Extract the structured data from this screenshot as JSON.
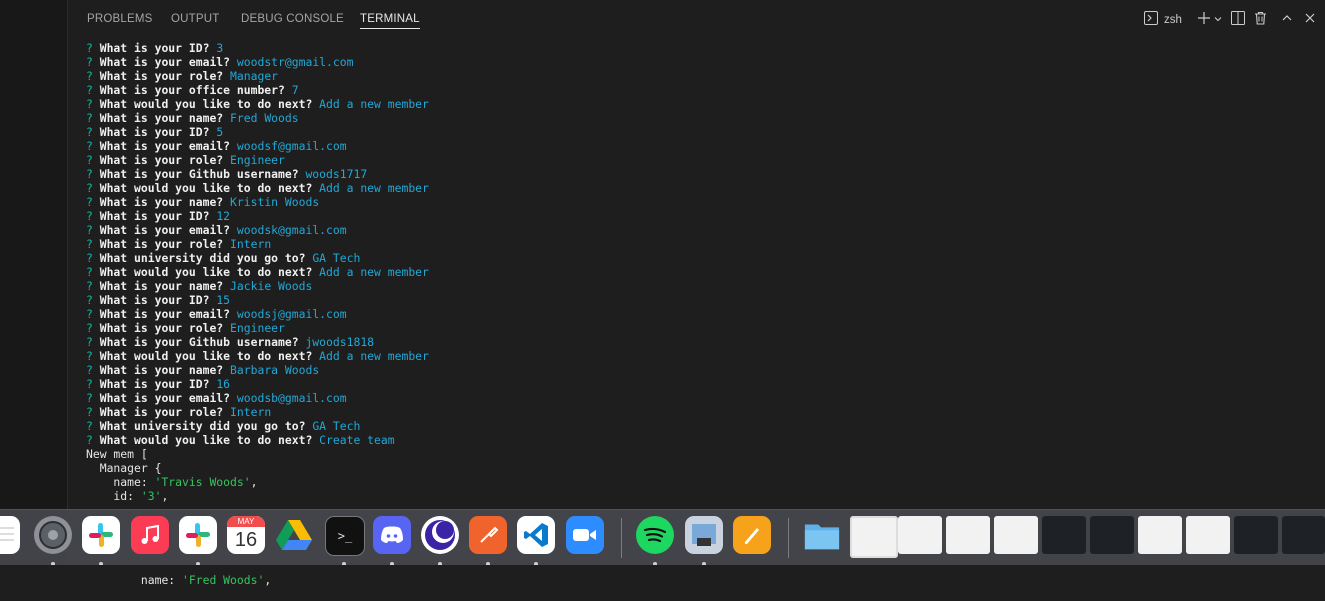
{
  "tabs": [
    {
      "label": "PROBLEMS"
    },
    {
      "label": "OUTPUT"
    },
    {
      "label": "DEBUG CONSOLE"
    },
    {
      "label": "TERMINAL"
    }
  ],
  "toolbar": {
    "shell_label": "zsh"
  },
  "terminal": {
    "prompt_char": "?",
    "lines": [
      {
        "prompt": "What is your ID?",
        "answer": "3"
      },
      {
        "prompt": "What is your email?",
        "answer": "woodstr@gmail.com"
      },
      {
        "prompt": "What is your role?",
        "answer": "Manager"
      },
      {
        "prompt": "What is your office number?",
        "answer": "7"
      },
      {
        "prompt": "What would you like to do next?",
        "answer": "Add a new member"
      },
      {
        "prompt": "What is your name?",
        "answer": "Fred Woods"
      },
      {
        "prompt": "What is your ID?",
        "answer": "5"
      },
      {
        "prompt": "What is your email?",
        "answer": "woodsf@gmail.com"
      },
      {
        "prompt": "What is your role?",
        "answer": "Engineer"
      },
      {
        "prompt": "What is your Github username?",
        "answer": "woods1717"
      },
      {
        "prompt": "What would you like to do next?",
        "answer": "Add a new member"
      },
      {
        "prompt": "What is your name?",
        "answer": "Kristin Woods"
      },
      {
        "prompt": "What is your ID?",
        "answer": "12"
      },
      {
        "prompt": "What is your email?",
        "answer": "woodsk@gmail.com"
      },
      {
        "prompt": "What is your role?",
        "answer": "Intern"
      },
      {
        "prompt": "What university did you go to?",
        "answer": "GA Tech"
      },
      {
        "prompt": "What would you like to do next?",
        "answer": "Add a new member"
      },
      {
        "prompt": "What is your name?",
        "answer": "Jackie Woods"
      },
      {
        "prompt": "What is your ID?",
        "answer": "15"
      },
      {
        "prompt": "What is your email?",
        "answer": "woodsj@gmail.com"
      },
      {
        "prompt": "What is your role?",
        "answer": "Engineer"
      },
      {
        "prompt": "What is your Github username?",
        "answer": "jwoods1818"
      },
      {
        "prompt": "What would you like to do next?",
        "answer": "Add a new member"
      },
      {
        "prompt": "What is your name?",
        "answer": "Barbara Woods"
      },
      {
        "prompt": "What is your ID?",
        "answer": "16"
      },
      {
        "prompt": "What is your email?",
        "answer": "woodsb@gmail.com"
      },
      {
        "prompt": "What is your role?",
        "answer": "Intern"
      },
      {
        "prompt": "What university did you go to?",
        "answer": "GA Tech"
      },
      {
        "prompt": "What would you like to do next?",
        "answer": "Create team"
      }
    ],
    "output": {
      "header": "New mem [",
      "class_line": "  Manager {",
      "name_key": "    name: ",
      "name_val": "'Travis Woods'",
      "name_end": ",",
      "id_key": "    id: ",
      "id_val": "'3'",
      "id_end": ",",
      "bottom_key": "    name: ",
      "bottom_val": "'Fred Woods'",
      "bottom_end": ","
    }
  },
  "dock": {
    "calendar_month": "MAY",
    "calendar_day": "16",
    "terminal_glyph": ">_"
  },
  "colors": {
    "terminal_bg": "#1e1e1e",
    "prompt_mark": "#14b8a6",
    "answer": "#20a8d8",
    "string": "#35c45e",
    "dock_bg": "#46484e"
  }
}
